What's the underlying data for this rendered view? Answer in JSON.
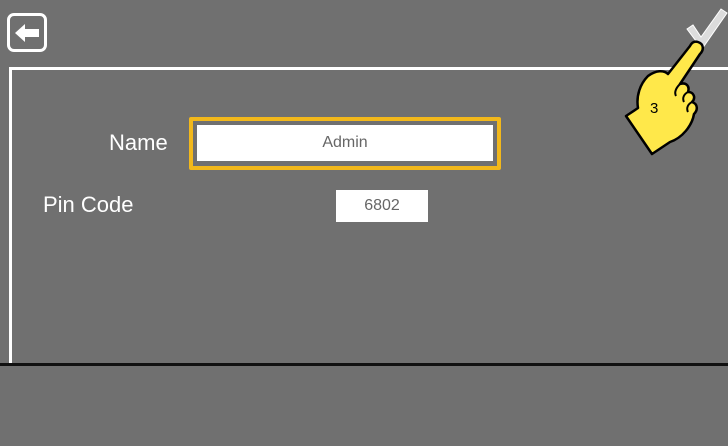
{
  "form": {
    "name_label": "Name",
    "name_value": "Admin",
    "pin_label": "Pin Code",
    "pin_value": "6802"
  },
  "icons": {
    "back": "arrow-left-icon",
    "confirm": "checkmark-icon",
    "pointer": "pointing-hand-icon"
  },
  "annotation": {
    "step": "3"
  },
  "colors": {
    "background": "#707070",
    "highlight": "#f2b81b",
    "hand_fill": "#ffe84a"
  }
}
